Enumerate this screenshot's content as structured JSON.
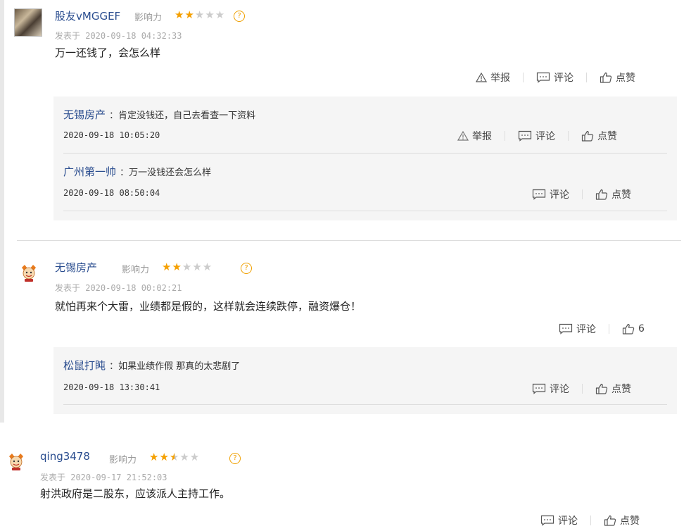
{
  "posts": [
    {
      "username": "股友vMGGEF",
      "influence_label": "影响力",
      "stars": 2,
      "posted": "发表于 2020-09-18 04:32:33",
      "content": "万一还钱了，会怎么样",
      "actions": {
        "report": "举报",
        "comment": "评论",
        "like": "点赞"
      },
      "replies": [
        {
          "name": "无锡房产",
          "text": "：肯定没钱还，自己去看查一下资料",
          "date": "2020-09-18 10:05:20",
          "actions": {
            "report": "举报",
            "comment": "评论",
            "like": "点赞"
          }
        },
        {
          "name": "广州第一帅",
          "text": "：万一没钱还会怎么样",
          "date": "2020-09-18 08:50:04",
          "actions": {
            "comment": "评论",
            "like": "点赞"
          }
        }
      ]
    },
    {
      "username": "无锡房产",
      "influence_label": "影响力",
      "stars": 2,
      "posted": "发表于 2020-09-18 00:02:21",
      "content": "就怕再来个大雷，业绩都是假的，这样就会连续跌停，融资爆仓！",
      "actions": {
        "comment": "评论",
        "like": "6"
      },
      "replies": [
        {
          "name": "松鼠打盹",
          "text": "：如果业绩作假 那真的太悲剧了",
          "date": "2020-09-18 13:30:41",
          "actions": {
            "comment": "评论",
            "like": "点赞"
          }
        }
      ]
    },
    {
      "username": "qing3478",
      "influence_label": "影响力",
      "stars": 2.5,
      "posted": "发表于 2020-09-17 21:52:03",
      "content": "射洪政府是二股东，应该派人主持工作。",
      "actions": {
        "comment": "评论",
        "like": "点赞"
      }
    }
  ],
  "icons": {
    "report": "warning-triangle-icon",
    "comment": "speech-bubble-icon",
    "like": "thumbs-up-icon",
    "help": "question-circle-icon"
  },
  "colors": {
    "username": "#2a4d8f",
    "star": "#f5a000",
    "reply_bg": "#f5f5f5"
  }
}
